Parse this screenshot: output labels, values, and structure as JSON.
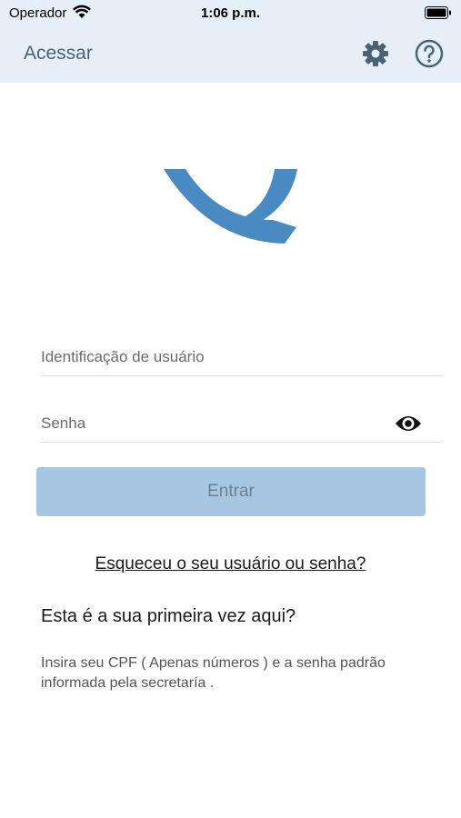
{
  "status_bar": {
    "carrier": "Operador",
    "time": "1:06 p.m."
  },
  "header": {
    "title": "Acessar",
    "icons": [
      "gear-icon",
      "help-icon"
    ]
  },
  "login": {
    "user_placeholder": "Identificação de usuário",
    "password_placeholder": "Senha",
    "submit_label": "Entrar",
    "forgot_link": "Esqueceu o seu usuário ou senha?"
  },
  "first_access": {
    "heading": "Esta é a sua primeira vez aqui?",
    "instructions": "Insira seu CPF ( Apenas números ) e a senha padrão informada pela secretaría ."
  },
  "colors": {
    "header_bg": "#e6eff7",
    "brand_blue": "#4a8ac2",
    "button_disabled": "#a7c6e1"
  }
}
